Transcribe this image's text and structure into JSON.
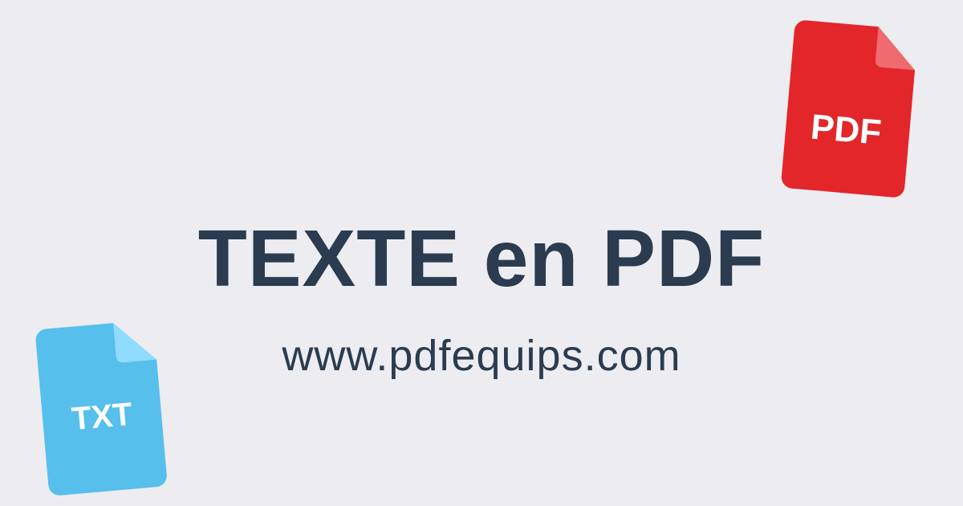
{
  "headline": "TEXTE en PDF",
  "site_url": "www.pdfequips.com",
  "icons": {
    "pdf": {
      "name": "pdf-file-icon",
      "label": "PDF",
      "body_color": "#e3262a",
      "fold_color": "#ef6b6f"
    },
    "txt": {
      "name": "txt-file-icon",
      "label": "TXT",
      "body_color": "#56bfec",
      "fold_color": "#8fdcff"
    }
  },
  "colors": {
    "background": "#ededf1",
    "text": "#2b3c50"
  }
}
